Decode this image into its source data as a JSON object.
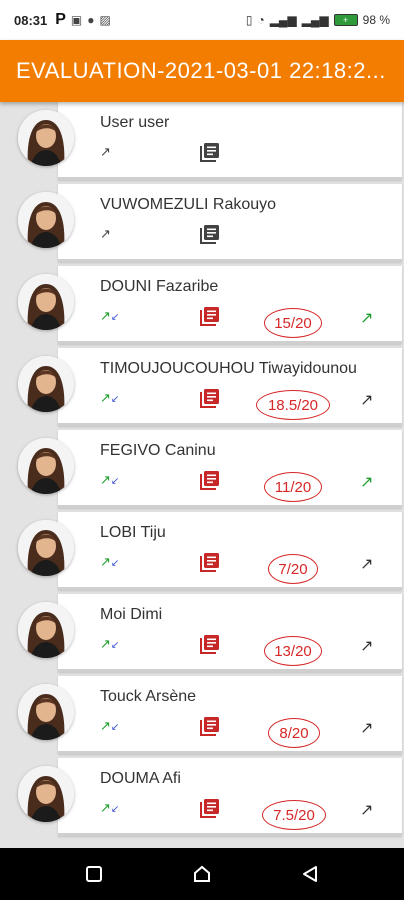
{
  "statusbar": {
    "time": "08:31",
    "p_icon": "P",
    "battery_percent": "98 %"
  },
  "appbar": {
    "title": "EVALUATION-2021-03-01 22:18:2..."
  },
  "colors": {
    "accent": "#f27d00",
    "grade_red": "#d62828",
    "trend_green": "#1e9e2c",
    "trend_blue": "#3a4fd0"
  },
  "students": [
    {
      "name": "User user",
      "grade": "",
      "doc_color": "gray",
      "mini": "gray",
      "right": ""
    },
    {
      "name": "VUWOMEZULI Rakouyo",
      "grade": "",
      "doc_color": "gray",
      "mini": "gray",
      "right": ""
    },
    {
      "name": "DOUNI Fazaribe",
      "grade": "15/20",
      "doc_color": "red",
      "mini": "updown",
      "right": "green"
    },
    {
      "name": "TIMOUJOUCOUHOU Tiwayidounou",
      "grade": "18.5/20",
      "doc_color": "red",
      "mini": "updown",
      "right": "gray"
    },
    {
      "name": "FEGIVO Caninu",
      "grade": "11/20",
      "doc_color": "red",
      "mini": "updown",
      "right": "green"
    },
    {
      "name": "LOBI Tiju",
      "grade": "7/20",
      "doc_color": "red",
      "mini": "updown",
      "right": "gray"
    },
    {
      "name": "Moi Dimi",
      "grade": "13/20",
      "doc_color": "red",
      "mini": "updown",
      "right": "gray"
    },
    {
      "name": "Touck Arsène",
      "grade": "8/20",
      "doc_color": "red",
      "mini": "updown",
      "right": "gray"
    },
    {
      "name": "DOUMA Afi",
      "grade": "7.5/20",
      "doc_color": "red",
      "mini": "updown",
      "right": "gray"
    }
  ]
}
